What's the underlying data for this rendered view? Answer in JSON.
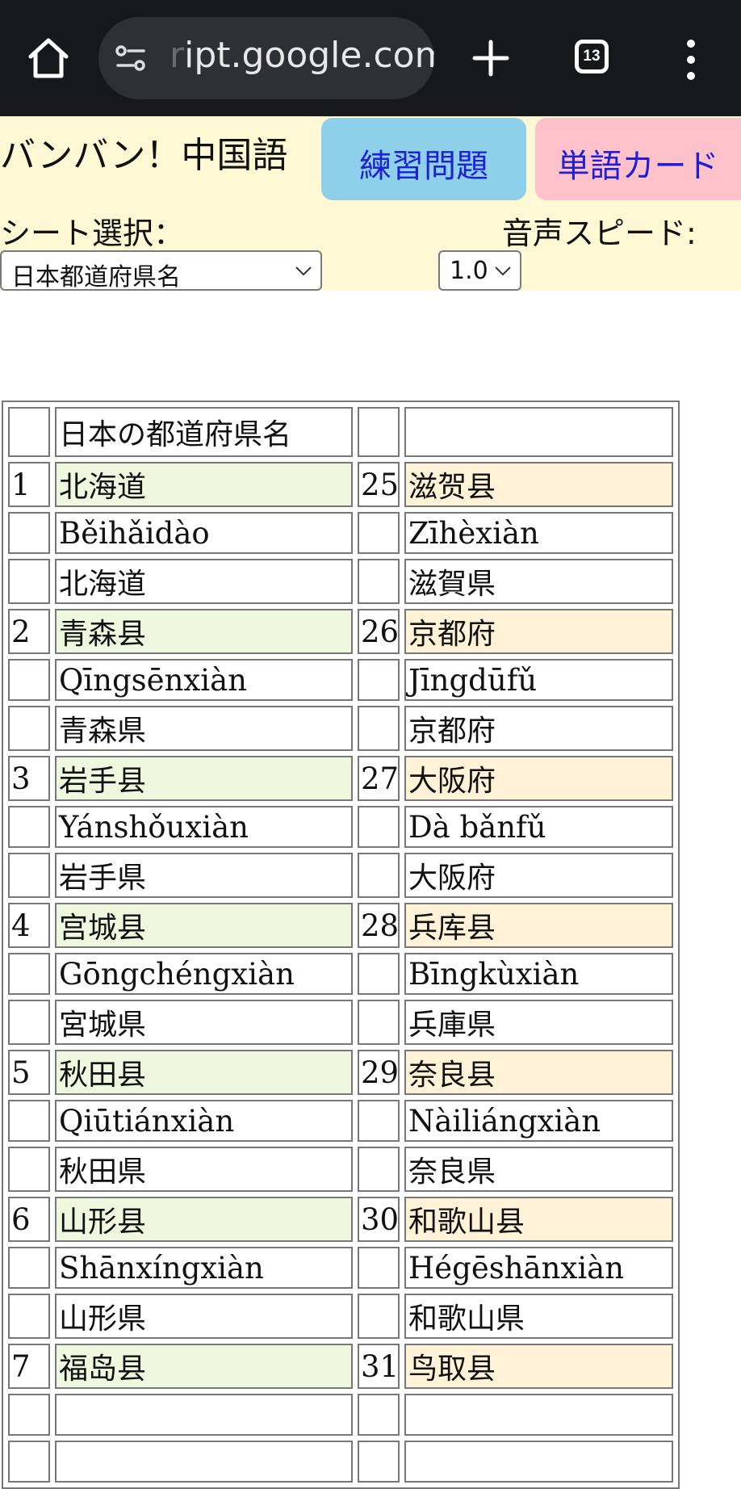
{
  "browser": {
    "url_faded": "r",
    "url": "ipt.google.com",
    "tab_count": "13"
  },
  "app": {
    "title": "バンバン！中国語",
    "practice_button": "練習問題",
    "cards_button": "単語カード",
    "sheet_label": "シート選択：",
    "speed_label": "音声スピード:",
    "sheet_value": "日本都道府県名",
    "speed_value": "1.0"
  },
  "colors": {
    "left_highlight": "#eff8df",
    "right_highlight": "#fff2d6",
    "practice_btn": "#8ecfea",
    "cards_btn": "#ffc2cb",
    "header_bg": "#fff8d5"
  },
  "table": {
    "header_left": "日本の都道府県名",
    "header_right": "",
    "rows": [
      {
        "ln": "1",
        "lc": "北海道",
        "lp": "Běihǎidào",
        "lj": "北海道",
        "rn": "25",
        "rc": "滋贺县",
        "rp": "Zīhèxiàn",
        "rj": "滋賀県"
      },
      {
        "ln": "2",
        "lc": "青森县",
        "lp": "Qīngsēnxiàn",
        "lj": "青森県",
        "rn": "26",
        "rc": "京都府",
        "rp": "Jīngdūfǔ",
        "rj": "京都府"
      },
      {
        "ln": "3",
        "lc": "岩手县",
        "lp": "Yánshǒuxiàn",
        "lj": "岩手県",
        "rn": "27",
        "rc": "大阪府",
        "rp": "Dà bǎnfǔ",
        "rj": "大阪府"
      },
      {
        "ln": "4",
        "lc": "宫城县",
        "lp": "Gōngchéngxiàn",
        "lj": "宮城県",
        "rn": "28",
        "rc": "兵库县",
        "rp": "Bīngkùxiàn",
        "rj": "兵庫県"
      },
      {
        "ln": "5",
        "lc": "秋田县",
        "lp": "Qiūtiánxiàn",
        "lj": "秋田県",
        "rn": "29",
        "rc": "奈良县",
        "rp": "Nàiliángxiàn",
        "rj": "奈良県"
      },
      {
        "ln": "6",
        "lc": "山形县",
        "lp": "Shānxíngxiàn",
        "lj": "山形県",
        "rn": "30",
        "rc": "和歌山县",
        "rp": "Hégēshānxiàn",
        "rj": "和歌山県"
      },
      {
        "ln": "7",
        "lc": "福岛县",
        "lp": "",
        "lj": "",
        "rn": "31",
        "rc": "鸟取县",
        "rp": "",
        "rj": ""
      }
    ]
  }
}
